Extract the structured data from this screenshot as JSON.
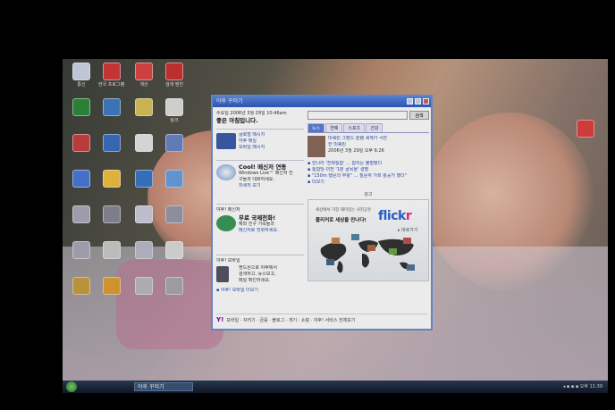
{
  "desktop_icons": [
    {
      "label": "통신",
      "color": "#cfd6e6"
    },
    {
      "label": "한국 프로그램 모음",
      "color": "#d43a3a"
    },
    {
      "label": "계산",
      "color": "#e04444"
    },
    {
      "label": "검색 엔진",
      "color": "#c33"
    },
    {
      "label": "",
      "color": "#2e8b3a"
    },
    {
      "label": "",
      "color": "#3e7cc5"
    },
    {
      "label": "",
      "color": "#d8c35a"
    },
    {
      "label": "링크",
      "color": "#e0e0e0"
    },
    {
      "label": "",
      "color": "#c94040"
    },
    {
      "label": "",
      "color": "#3a6fbf"
    },
    {
      "label": "",
      "color": "#e6e6e6"
    },
    {
      "label": "",
      "color": "#6a86c6"
    },
    {
      "label": "",
      "color": "#4a7ad9"
    },
    {
      "label": "",
      "color": "#f0c040"
    },
    {
      "label": "",
      "color": "#3a76c8"
    },
    {
      "label": "",
      "color": "#6aa0e0"
    },
    {
      "label": "",
      "color": "#aab"
    },
    {
      "label": "",
      "color": "#889"
    },
    {
      "label": "",
      "color": "#ccd"
    },
    {
      "label": "",
      "color": "#99a"
    },
    {
      "label": "",
      "color": "#aab"
    },
    {
      "label": "",
      "color": "#ccc"
    },
    {
      "label": "",
      "color": "#bbc"
    },
    {
      "label": "",
      "color": "#ddd"
    },
    {
      "label": "",
      "color": "#c9a040"
    },
    {
      "label": "",
      "color": "#e0a030"
    },
    {
      "label": "",
      "color": "#bbb"
    },
    {
      "label": "",
      "color": "#aaa"
    },
    {
      "label": "",
      "color": "#e04040"
    }
  ],
  "window": {
    "title": "야후 꾸러기",
    "greeting_small": "수요일 2006년 3월 29일 10:46am",
    "greeting": "좋은 아침입니다.",
    "mail_label1": "글로벌 메시지",
    "mail_label2": "야후 메일",
    "mail_label3": "모바일 메시지",
    "ad1_title": "Cool! 메신저 연동",
    "ad1_line1": "Windows Live™ 메신저 친",
    "ad1_line2": "구들과 대화하세요.",
    "ad1_link": "자세히 보기",
    "messenger_head": "야후! 메신저",
    "messenger_title": "무료 국제전화!",
    "messenger_line1": "해외 친구 가족들과",
    "messenger_link": "메신저로 전화하세요.",
    "mobile_head": "야후! 모바일",
    "mobile_line1": "핸드폰으로 야후에서",
    "mobile_line2": "검색하고, 뉴스보고,",
    "mobile_line3": "메일 확인하세요.",
    "mobile_link": "▪ 야후! 모바일 더보기",
    "search_button": "검색",
    "tabs": [
      "뉴스",
      "연예",
      "스포츠",
      "건강"
    ],
    "news_headline1": "미쉐린 그랜드 슬램 세계가 극찬",
    "news_headline2": "한 미쉐린",
    "news_date": "2006년 3월 29일 오후 6:26",
    "news_items": [
      "▪ 한나라 '전략통합' ... 합의는 불발됐다",
      "▪ 통합당-의전 '1분 골목을' 결별",
      "▪ \"150m 행운의 부활\" ... 질문자 가르 활공가 했다\"",
      "▪ 더보기"
    ],
    "ad_header": "광고",
    "ad_top": "세상에서 가장 재미있는 사진공유",
    "ad_sub": "플리커로 세상을 만나다!",
    "flickr_part1": "flick",
    "flickr_part2": "r",
    "ad_more": "▸ 바로가기",
    "bottom_links": "모바일 · 꾸러기 · 금융 · 블로그 · 게기 · 쇼핑 · 야후! 서비스 전체보기",
    "bottom_logo": "Y!"
  },
  "taskbar": {
    "window_button": "야후 꾸러기",
    "tray_text": "◂ ▪ ▪ ▪ 오후 11:39"
  },
  "colors": {
    "window_border": "#6b8fd6",
    "flickr_blue": "#2a64d1",
    "flickr_pink": "#ff1f8c",
    "yahoo_purple": "#7b0099"
  }
}
